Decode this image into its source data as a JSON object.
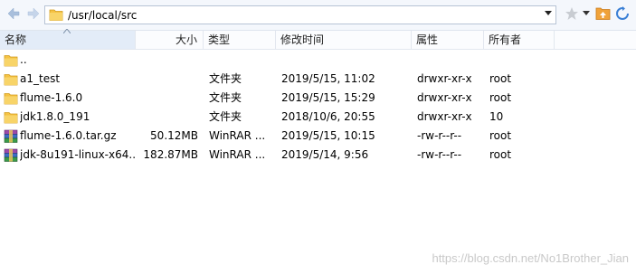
{
  "address_bar": {
    "path": "/usr/local/src"
  },
  "icons": {
    "back": "back-arrow-icon",
    "forward": "forward-arrow-icon",
    "folder": "folder-icon",
    "dropdown": "chevron-down-icon",
    "bookmark": "star-icon",
    "up": "parent-folder-icon",
    "refresh": "refresh-icon",
    "archive": "winrar-archive-icon"
  },
  "columns": {
    "name": "名称",
    "size": "大小",
    "type": "类型",
    "mtime": "修改时间",
    "attr": "属性",
    "owner": "所有者"
  },
  "files": [
    {
      "name": "..",
      "size": "",
      "type": "",
      "mtime": "",
      "attr": "",
      "owner": "",
      "icon": "folder"
    },
    {
      "name": "a1_test",
      "size": "",
      "type": "文件夹",
      "mtime": "2019/5/15, 11:02",
      "attr": "drwxr-xr-x",
      "owner": "root",
      "icon": "folder"
    },
    {
      "name": "flume-1.6.0",
      "size": "",
      "type": "文件夹",
      "mtime": "2019/5/15, 15:29",
      "attr": "drwxr-xr-x",
      "owner": "root",
      "icon": "folder"
    },
    {
      "name": "jdk1.8.0_191",
      "size": "",
      "type": "文件夹",
      "mtime": "2018/10/6, 20:55",
      "attr": "drwxr-xr-x",
      "owner": "10",
      "icon": "folder"
    },
    {
      "name": "flume-1.6.0.tar.gz",
      "size": "50.12MB",
      "type": "WinRAR ...",
      "mtime": "2019/5/15, 10:15",
      "attr": "-rw-r--r--",
      "owner": "root",
      "icon": "archive"
    },
    {
      "name": "jdk-8u191-linux-x64...",
      "size": "182.87MB",
      "type": "WinRAR ...",
      "mtime": "2019/5/14, 9:56",
      "attr": "-rw-r--r--",
      "owner": "root",
      "icon": "archive"
    }
  ],
  "watermark": "https://blog.csdn.net/No1Brother_Jian",
  "colors": {
    "toolbar_bg": "#f4f7fc",
    "header_selected_bg": "#e3ecf8",
    "folder_yellow": "#f5c243",
    "archive_purple": "#7b3f8f"
  }
}
